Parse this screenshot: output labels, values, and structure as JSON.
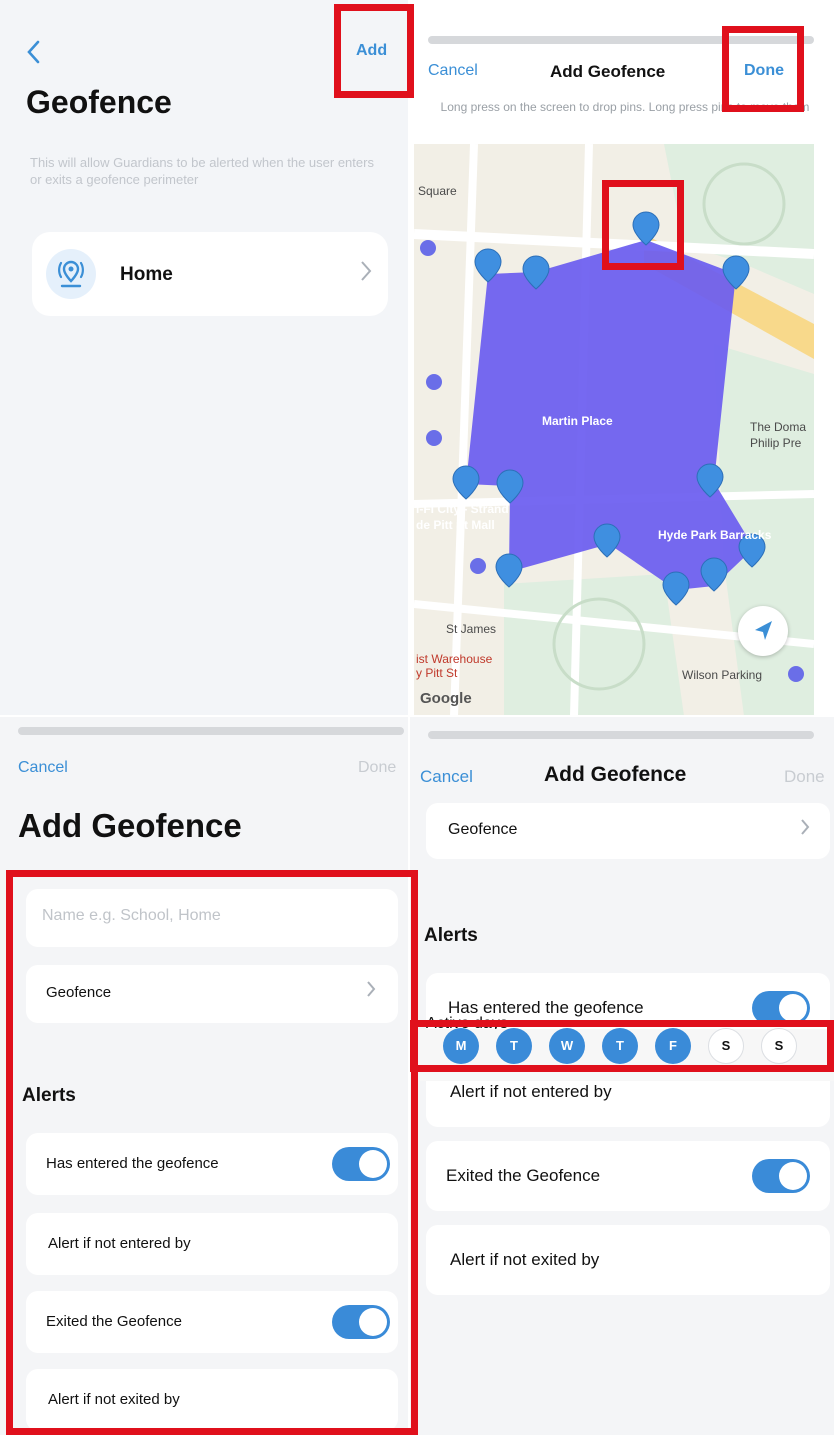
{
  "screen1": {
    "back_icon": "chevron-left-icon",
    "add_label": "Add",
    "title": "Geofence",
    "description": "This will allow Guardians to be alerted when the user enters or exits a geofence perimeter",
    "items": [
      {
        "label": "Home",
        "icon": "geofence-pin-icon"
      }
    ]
  },
  "screen2": {
    "cancel_label": "Cancel",
    "title": "Add Geofence",
    "done_label": "Done",
    "hint": "Long press on the screen to drop pins. Long press pins to move them",
    "map_labels": {
      "square": "Square",
      "martin_place": "Martin Place",
      "domain": "The Doma",
      "philip": "Philip Pre",
      "hifi": "i-Fi City - Strand",
      "pitt_mall": "de Pitt St Mall",
      "hyde_park": "Hyde Park Barracks",
      "st_james": "St James",
      "warehouse": "ist Warehouse",
      "pitt_st": "y Pitt St",
      "wilson": "Wilson Parking",
      "google": "Google"
    },
    "colors": {
      "fence_fill": "#6a5cf0",
      "pin": "#3f8fe0",
      "park": "#dfeee0"
    }
  },
  "screen3": {
    "cancel_label": "Cancel",
    "done_label": "Done",
    "title": "Add Geofence",
    "name_placeholder": "Name e.g. School, Home",
    "geofence_label": "Geofence",
    "alerts_header": "Alerts",
    "entered_label": "Has entered the geofence",
    "entered_on": true,
    "not_entered_label": "Alert if not entered by",
    "exited_label": "Exited the Geofence",
    "exited_on": true,
    "not_exited_label": "Alert if not exited by"
  },
  "screen4": {
    "cancel_label": "Cancel",
    "title": "Add Geofence",
    "done_label": "Done",
    "geofence_label": "Geofence",
    "alerts_header": "Alerts",
    "entered_label": "Has entered the geofence",
    "not_entered_label": "Alert if not entered by",
    "exited_label": "Exited the Geofence",
    "not_exited_label": "Alert if not exited by",
    "active_days_label": "Active days",
    "days": [
      {
        "label": "M",
        "active": true
      },
      {
        "label": "T",
        "active": true
      },
      {
        "label": "W",
        "active": true
      },
      {
        "label": "T",
        "active": true
      },
      {
        "label": "F",
        "active": true
      },
      {
        "label": "S",
        "active": false
      },
      {
        "label": "S",
        "active": false
      }
    ]
  },
  "accent_color": "#3b8fd6",
  "highlight_color": "#e0101c"
}
